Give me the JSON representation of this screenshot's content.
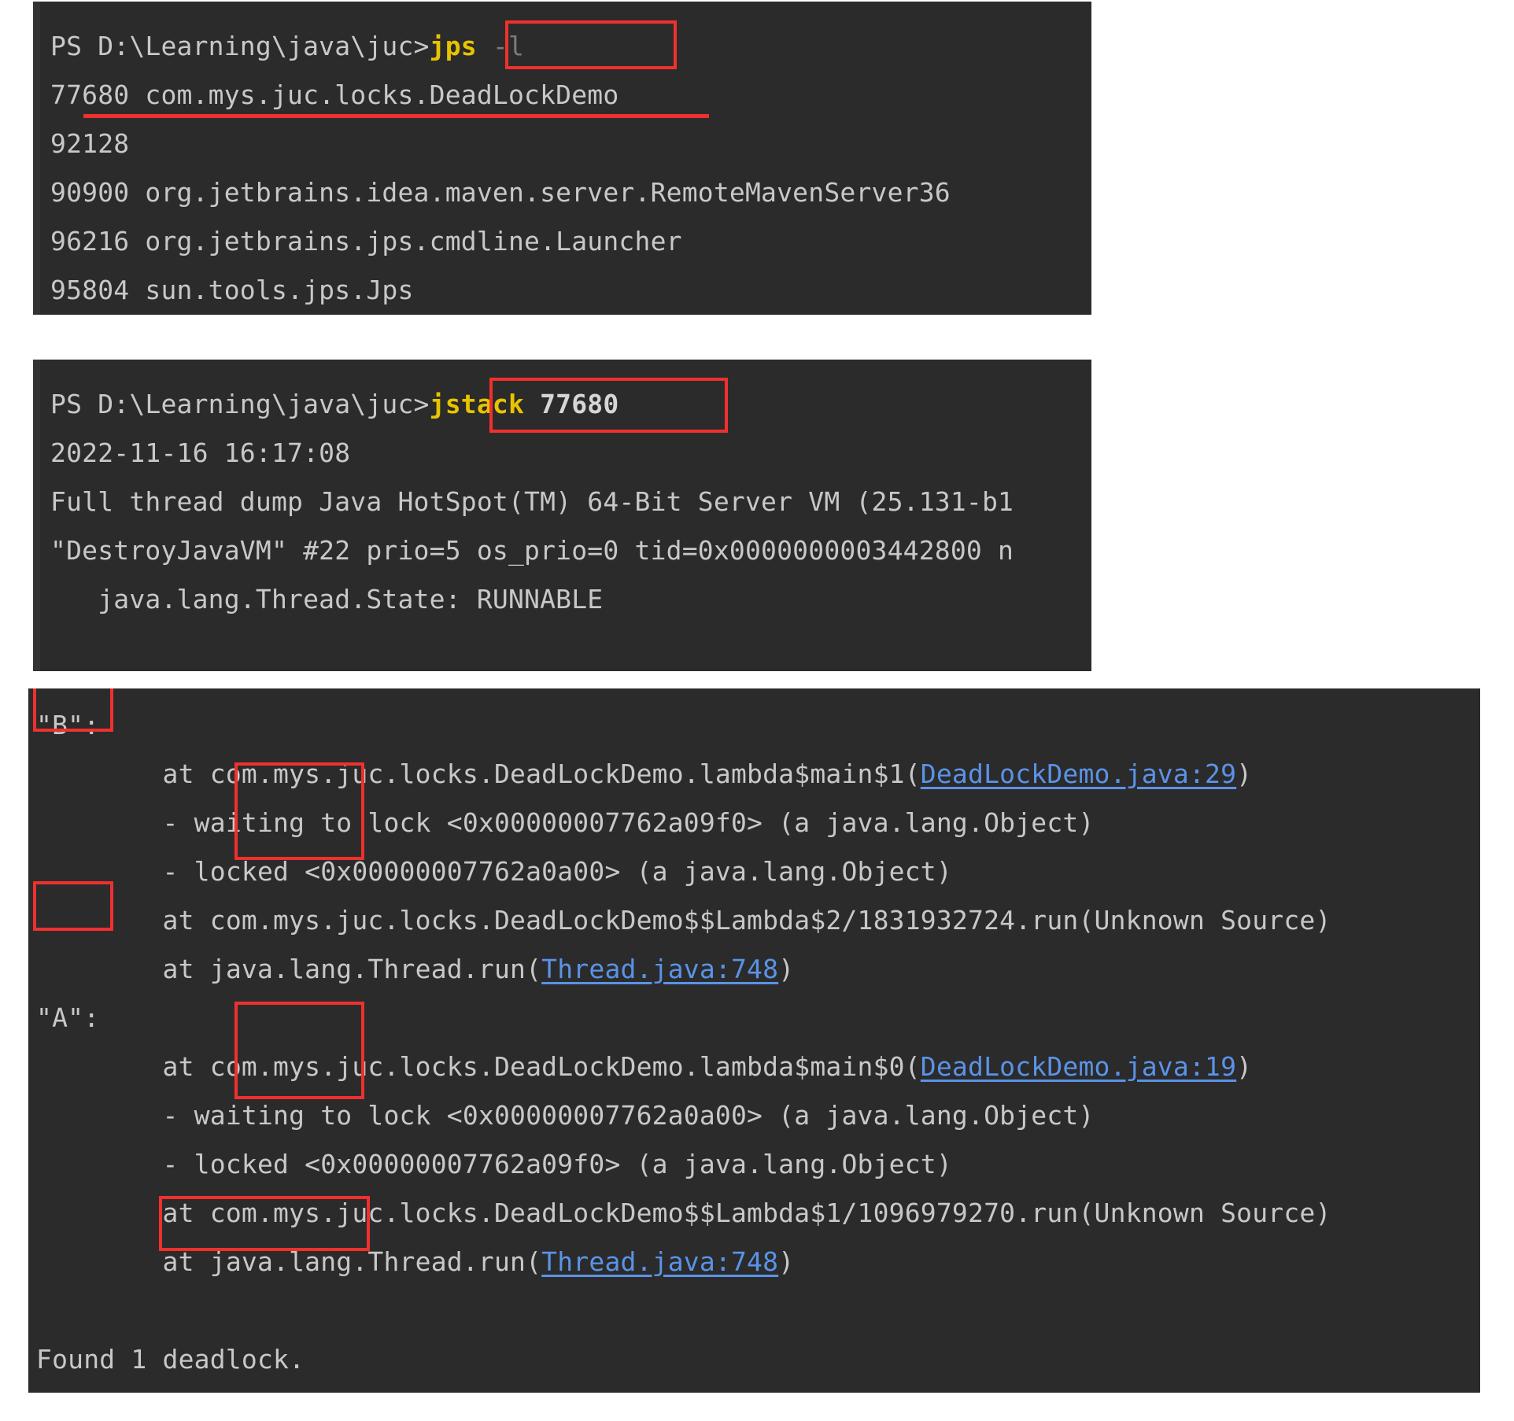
{
  "theme": {
    "terminal_bg": "#2b2b2b",
    "terminal_fg": "#c8c8c8",
    "annotation_red": "#f0302e",
    "command_yellow": "#e8c300",
    "link_blue": "#5a93e8",
    "page_bg": "#ffffff"
  },
  "panels": {
    "jps": {
      "prompt": "PS D:\\Learning\\java\\juc>",
      "command": "jps",
      "command_arg": "-l",
      "output": [
        "77680 com.mys.juc.locks.DeadLockDemo",
        "92128",
        "90900 org.jetbrains.idea.maven.server.RemoteMavenServer36",
        "96216 org.jetbrains.jps.cmdline.Launcher",
        "95804 sun.tools.jps.Jps"
      ],
      "highlighted_pid": "77680"
    },
    "jstack": {
      "prompt": "PS D:\\Learning\\java\\juc>",
      "command": "jstack",
      "command_arg": "77680",
      "output": [
        "2022-11-16 16:17:08",
        "Full thread dump Java HotSpot(TM) 64-Bit Server VM (25.131-b1",
        "",
        "\"DestroyJavaVM\" #22 prio=5 os_prio=0 tid=0x0000000003442800 n",
        "   java.lang.Thread.State: RUNNABLE"
      ]
    },
    "dump": {
      "thread_b_label": "\"B\":",
      "thread_b_lines": [
        {
          "indent": "        ",
          "pre": "at com.mys.juc.locks.DeadLockDemo.lambda$main$1(",
          "link": "DeadLockDemo.java:29",
          "post": ")"
        },
        {
          "indent": "        ",
          "pre": "- waiting to lock <0x00000007762a09f0> (a java.lang.Object)",
          "link": "",
          "post": ""
        },
        {
          "indent": "        ",
          "pre": "- locked <0x00000007762a0a00> (a java.lang.Object)",
          "link": "",
          "post": ""
        },
        {
          "indent": "        ",
          "pre": "at com.mys.juc.locks.DeadLockDemo$$Lambda$2/1831932724.run(Unknown Source)",
          "link": "",
          "post": ""
        },
        {
          "indent": "        ",
          "pre": "at java.lang.Thread.run(",
          "link": "Thread.java:748",
          "post": ")"
        }
      ],
      "thread_a_label": "\"A\":",
      "thread_a_lines": [
        {
          "indent": "        ",
          "pre": "at com.mys.juc.locks.DeadLockDemo.lambda$main$0(",
          "link": "DeadLockDemo.java:19",
          "post": ")"
        },
        {
          "indent": "        ",
          "pre": "- waiting to lock <0x00000007762a0a00> (a java.lang.Object)",
          "link": "",
          "post": ""
        },
        {
          "indent": "        ",
          "pre": "- locked <0x00000007762a09f0> (a java.lang.Object)",
          "link": "",
          "post": ""
        },
        {
          "indent": "        ",
          "pre": "at com.mys.juc.locks.DeadLockDemo$$Lambda$1/1096979270.run(Unknown Source)",
          "link": "",
          "post": ""
        },
        {
          "indent": "        ",
          "pre": "at java.lang.Thread.run(",
          "link": "Thread.java:748",
          "post": ")"
        }
      ],
      "found_prefix": "Found ",
      "found_highlight": "1 deadlock."
    }
  },
  "annotations": {
    "box_jps_command": "jps -l",
    "underline_pid_line": "77680 com.mys.juc.locks.DeadLockDemo",
    "box_jstack_command": "jstack 77680",
    "box_thread_b": "\"B\":",
    "box_thread_a": "\"A\":",
    "box_waiting_locked_b": "waiting / locked",
    "box_waiting_locked_a": "waiting / locked",
    "box_found_deadlock": "1 deadlock."
  }
}
